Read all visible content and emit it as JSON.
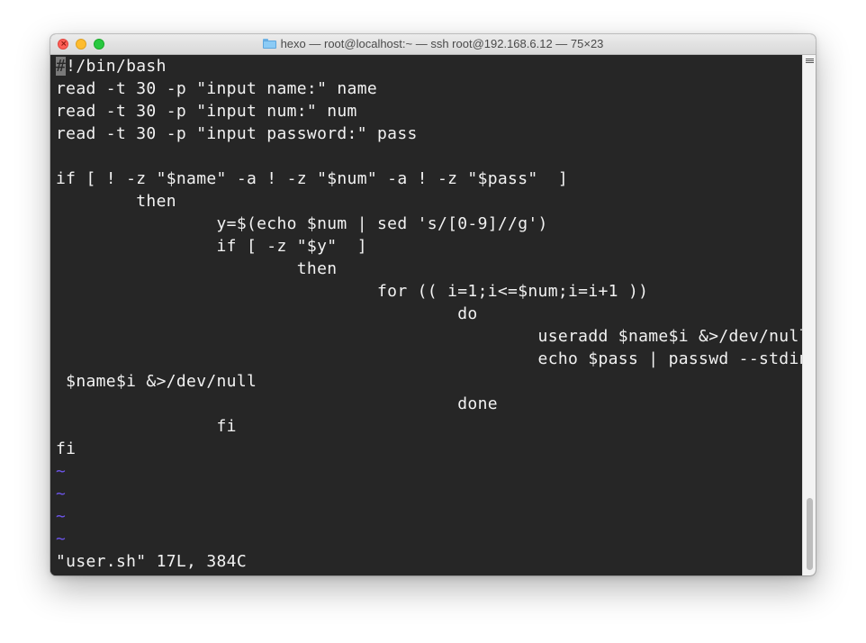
{
  "window": {
    "title": "hexo — root@localhost:~ — ssh root@192.168.6.12 — 75×23"
  },
  "terminal": {
    "lines": [
      {
        "text": "!/bin/bash",
        "cursor_char": "#"
      },
      {
        "text": "read -t 30 -p \"input name:\" name"
      },
      {
        "text": "read -t 30 -p \"input num:\" num"
      },
      {
        "text": "read -t 30 -p \"input password:\" pass"
      },
      {
        "text": ""
      },
      {
        "text": "if [ ! -z \"$name\" -a ! -z \"$num\" -a ! -z \"$pass\"  ]"
      },
      {
        "text": "        then"
      },
      {
        "text": "                y=$(echo $num | sed 's/[0-9]//g')"
      },
      {
        "text": "                if [ -z \"$y\"  ]"
      },
      {
        "text": "                        then"
      },
      {
        "text": "                                for (( i=1;i<=$num;i=i+1 ))"
      },
      {
        "text": "                                        do"
      },
      {
        "text": "                                                useradd $name$i &>/dev/null"
      },
      {
        "text": "                                                echo $pass | passwd --stdin"
      },
      {
        "text": " $name$i &>/dev/null"
      },
      {
        "text": "                                        done"
      },
      {
        "text": "                fi"
      },
      {
        "text": "fi"
      },
      {
        "text": "~"
      },
      {
        "text": "~"
      },
      {
        "text": "~"
      },
      {
        "text": "~"
      }
    ],
    "status_line": "\"user.sh\" 17L, 384C"
  },
  "colors": {
    "background": "#262626",
    "foreground": "#f2f2f2",
    "tilde": "#6c55e8"
  }
}
